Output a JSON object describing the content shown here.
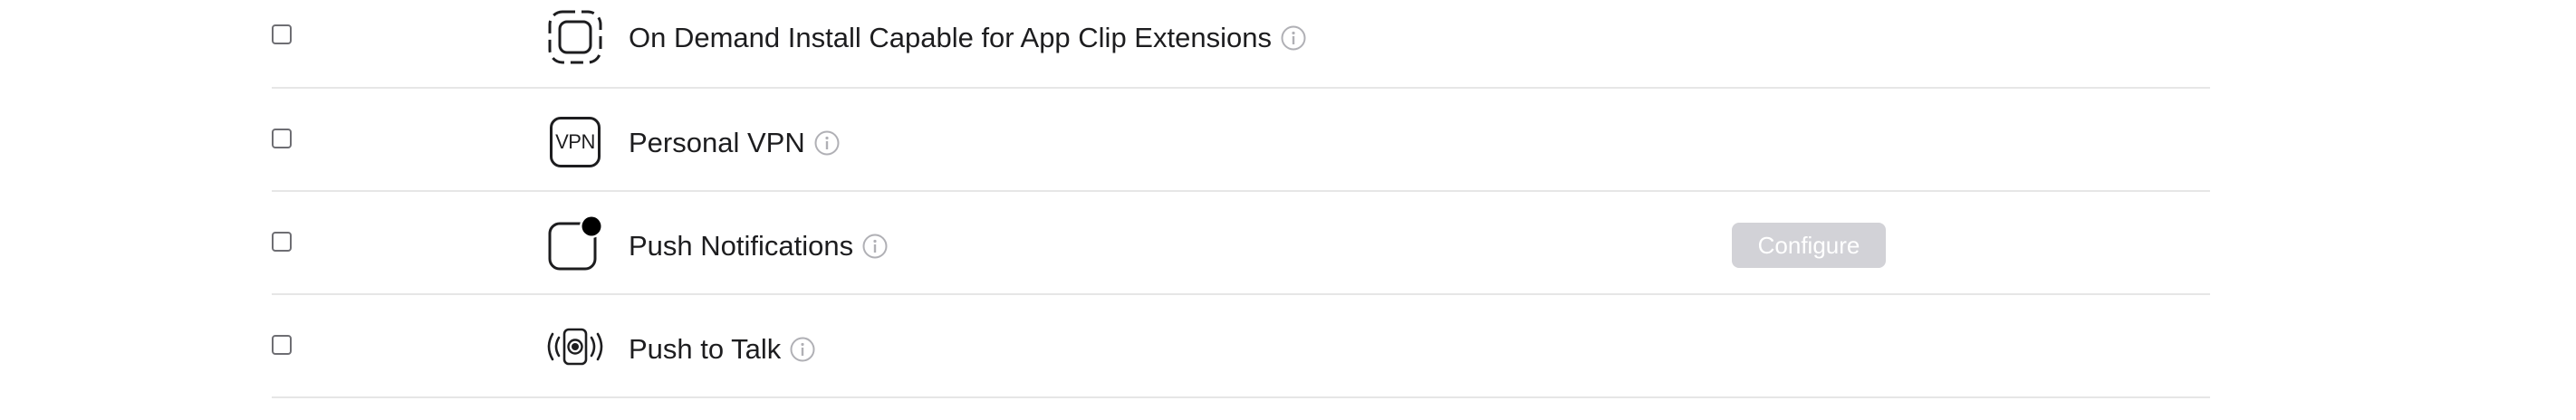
{
  "capabilities": [
    {
      "label": "On Demand Install Capable for App Clip Extensions",
      "icon": "app-clip-dashed-square-icon",
      "checked": false
    },
    {
      "label": "Personal VPN",
      "icon": "vpn-icon",
      "icon_text": "VPN",
      "checked": false
    },
    {
      "label": "Push Notifications",
      "icon": "push-notification-badge-icon",
      "checked": false,
      "configure_label": "Configure"
    },
    {
      "label": "Push to Talk",
      "icon": "push-to-talk-broadcast-icon",
      "checked": false
    }
  ],
  "colors": {
    "text": "#1d1d1f",
    "divider": "#e6e6e6",
    "info_icon": "#b0b0b5",
    "configure_disabled_bg": "#d2d2d7",
    "configure_disabled_text": "#ffffff"
  }
}
